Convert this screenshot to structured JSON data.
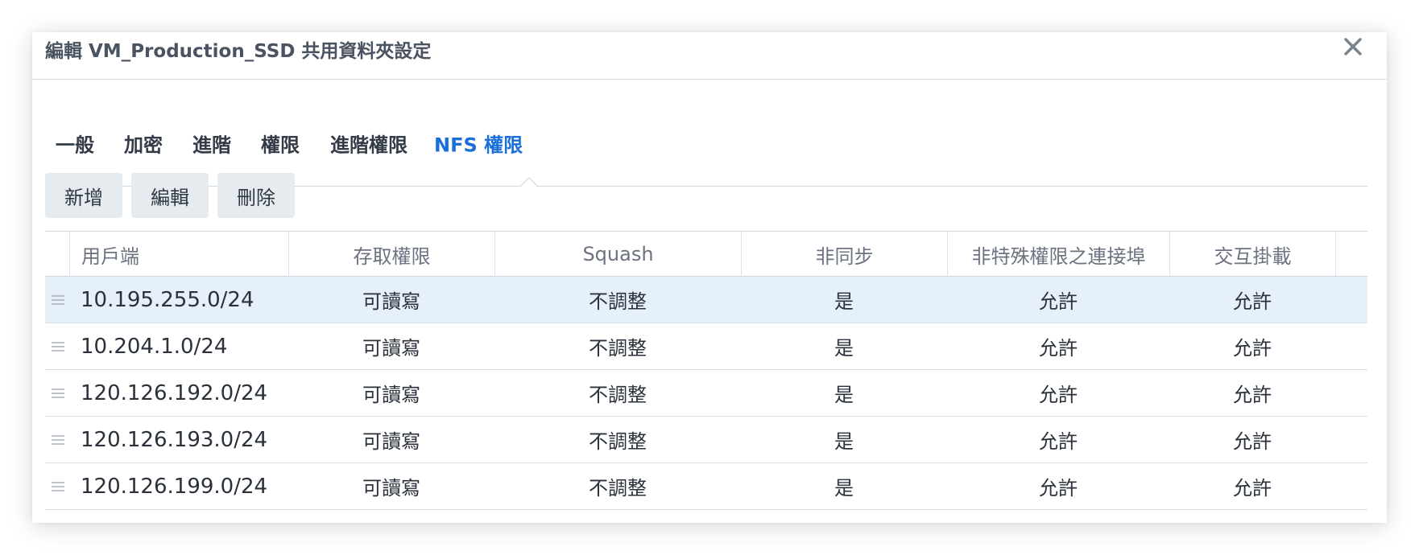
{
  "dialog": {
    "title": "編輯 VM_Production_SSD 共用資料夾設定",
    "close_icon": "close-icon"
  },
  "tabs": [
    {
      "label": "一般",
      "active": false
    },
    {
      "label": "加密",
      "active": false
    },
    {
      "label": "進階",
      "active": false
    },
    {
      "label": "權限",
      "active": false
    },
    {
      "label": "進階權限",
      "active": false
    },
    {
      "label": "NFS 權限",
      "active": true
    }
  ],
  "toolbar": {
    "add_label": "新增",
    "edit_label": "編輯",
    "delete_label": "刪除"
  },
  "table": {
    "columns": [
      "用戶端",
      "存取權限",
      "Squash",
      "非同步",
      "非特殊權限之連接埠",
      "交互掛載"
    ],
    "rows": [
      {
        "client": "10.195.255.0/24",
        "access": "可讀寫",
        "squash": "不調整",
        "async": "是",
        "nonpriv_port": "允許",
        "crossmnt": "允許",
        "selected": true
      },
      {
        "client": "10.204.1.0/24",
        "access": "可讀寫",
        "squash": "不調整",
        "async": "是",
        "nonpriv_port": "允許",
        "crossmnt": "允許",
        "selected": false
      },
      {
        "client": "120.126.192.0/24",
        "access": "可讀寫",
        "squash": "不調整",
        "async": "是",
        "nonpriv_port": "允許",
        "crossmnt": "允許",
        "selected": false
      },
      {
        "client": "120.126.193.0/24",
        "access": "可讀寫",
        "squash": "不調整",
        "async": "是",
        "nonpriv_port": "允許",
        "crossmnt": "允許",
        "selected": false
      },
      {
        "client": "120.126.199.0/24",
        "access": "可讀寫",
        "squash": "不調整",
        "async": "是",
        "nonpriv_port": "允許",
        "crossmnt": "允許",
        "selected": false
      }
    ]
  },
  "colors": {
    "accent": "#1a6fd9",
    "selected_row": "#e5f0fb",
    "button_bg": "#e6ebf0"
  }
}
